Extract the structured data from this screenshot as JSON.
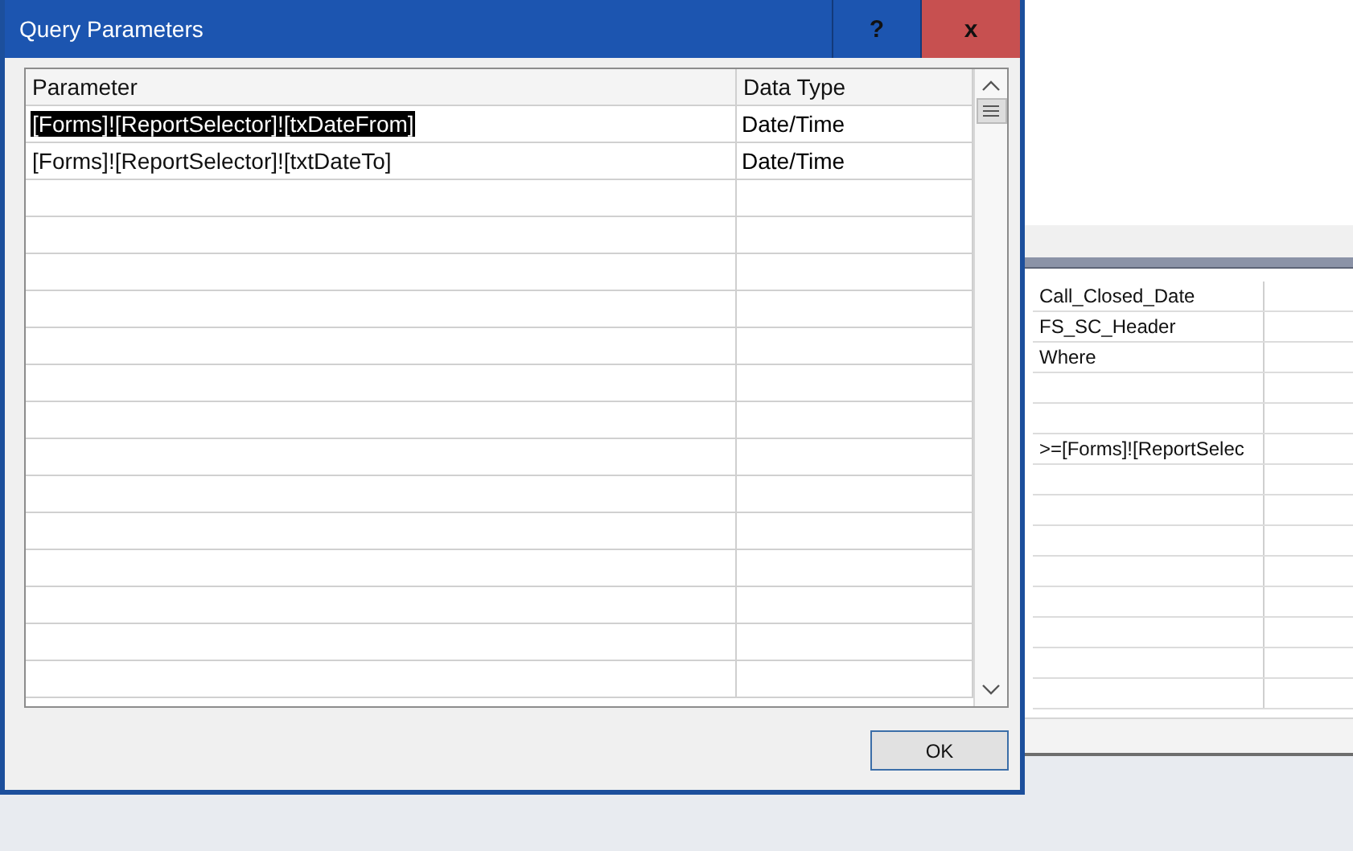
{
  "background_grid": {
    "rows": [
      {
        "column_1": "Call_Closed_Date"
      },
      {
        "column_1": "FS_SC_Header"
      },
      {
        "column_1": "Where"
      },
      {
        "column_1": ""
      },
      {
        "column_1": ""
      },
      {
        "column_1": ">=[Forms]![ReportSelec"
      }
    ]
  },
  "dialog": {
    "title": "Query Parameters",
    "help_button": "?",
    "close_button": "x",
    "columns": [
      "Parameter",
      "Data Type"
    ],
    "rows": [
      {
        "parameter": "[Forms]![ReportSelector]![txDateFrom]",
        "data_type": "Date/Time",
        "selected": true
      },
      {
        "parameter": "[Forms]![ReportSelector]![txtDateTo]",
        "data_type": "Date/Time",
        "selected": false
      }
    ],
    "ok_button": "OK"
  }
}
